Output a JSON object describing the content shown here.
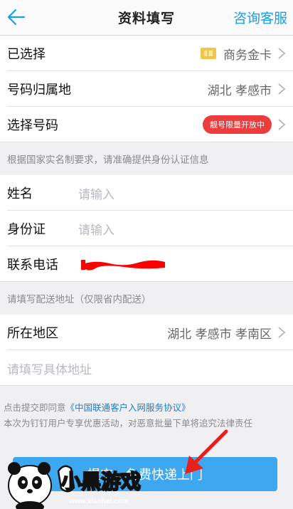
{
  "nav": {
    "title": "资料填写",
    "service": "咨询客服"
  },
  "selected": {
    "label": "已选择",
    "value": "商务金卡"
  },
  "location": {
    "label": "号码归属地",
    "value": "湖北 孝感市"
  },
  "choose_number": {
    "label": "选择号码",
    "badge": "靓号限量开放中"
  },
  "hint_identity": "根据国家实名制要求，请准确提供身份认证信息",
  "name": {
    "label": "姓名",
    "placeholder": "请输入"
  },
  "id_card": {
    "label": "身份证",
    "placeholder": "请输入"
  },
  "phone": {
    "label": "联系电话"
  },
  "hint_address": "请填写配送地址（仅限省内配送）",
  "region": {
    "label": "所在地区",
    "value": "湖北 孝感市 孝南区"
  },
  "address": {
    "placeholder": "请填写具体地址"
  },
  "agree": {
    "prefix": "点击提交即同意",
    "link": "《中国联通客户入网服务协议》",
    "note": "本次为钉钉用户专享优惠活动，对恶意批量下单将追究法律责任"
  },
  "submit_label": "提交，免费快递上门",
  "watermark": {
    "text": "小黑游戏",
    "url": "www.xiaohei.com"
  },
  "colors": {
    "accent": "#1aa0e6",
    "badge": "#ee3b3b",
    "button": "#3da8ef",
    "mask": "#ff0000",
    "arrow": "#e8201a"
  }
}
